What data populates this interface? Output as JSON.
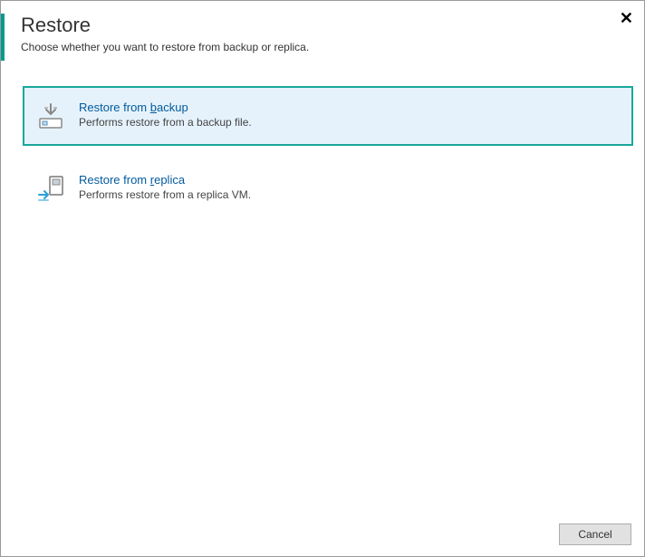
{
  "header": {
    "title": "Restore",
    "subtitle": "Choose whether you want to restore from backup or replica."
  },
  "options": {
    "backup": {
      "title_before": "Restore from ",
      "title_mnemonic": "b",
      "title_after": "ackup",
      "desc": "Performs restore from a backup file."
    },
    "replica": {
      "title_before": "Restore from ",
      "title_mnemonic": "r",
      "title_after": "eplica",
      "desc": "Performs restore from a replica VM."
    }
  },
  "footer": {
    "cancel": "Cancel"
  },
  "close": "✕"
}
